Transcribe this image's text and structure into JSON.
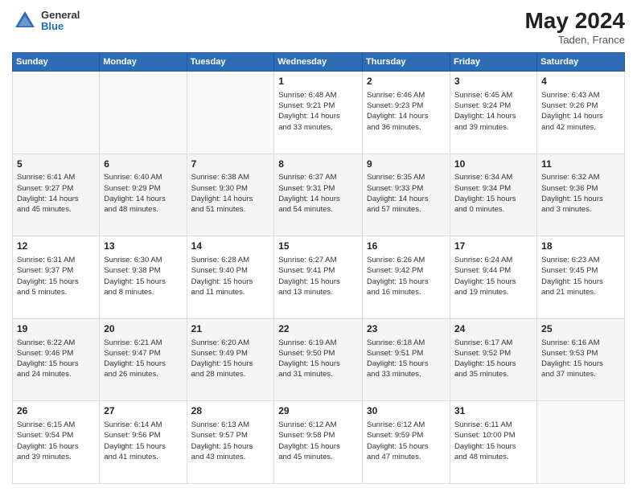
{
  "header": {
    "logo": {
      "general": "General",
      "blue": "Blue"
    },
    "title": "May 2024",
    "location": "Taden, France"
  },
  "calendar": {
    "days_of_week": [
      "Sunday",
      "Monday",
      "Tuesday",
      "Wednesday",
      "Thursday",
      "Friday",
      "Saturday"
    ],
    "weeks": [
      [
        {
          "day": "",
          "info": ""
        },
        {
          "day": "",
          "info": ""
        },
        {
          "day": "",
          "info": ""
        },
        {
          "day": "1",
          "info": "Sunrise: 6:48 AM\nSunset: 9:21 PM\nDaylight: 14 hours\nand 33 minutes."
        },
        {
          "day": "2",
          "info": "Sunrise: 6:46 AM\nSunset: 9:23 PM\nDaylight: 14 hours\nand 36 minutes."
        },
        {
          "day": "3",
          "info": "Sunrise: 6:45 AM\nSunset: 9:24 PM\nDaylight: 14 hours\nand 39 minutes."
        },
        {
          "day": "4",
          "info": "Sunrise: 6:43 AM\nSunset: 9:26 PM\nDaylight: 14 hours\nand 42 minutes."
        }
      ],
      [
        {
          "day": "5",
          "info": "Sunrise: 6:41 AM\nSunset: 9:27 PM\nDaylight: 14 hours\nand 45 minutes."
        },
        {
          "day": "6",
          "info": "Sunrise: 6:40 AM\nSunset: 9:29 PM\nDaylight: 14 hours\nand 48 minutes."
        },
        {
          "day": "7",
          "info": "Sunrise: 6:38 AM\nSunset: 9:30 PM\nDaylight: 14 hours\nand 51 minutes."
        },
        {
          "day": "8",
          "info": "Sunrise: 6:37 AM\nSunset: 9:31 PM\nDaylight: 14 hours\nand 54 minutes."
        },
        {
          "day": "9",
          "info": "Sunrise: 6:35 AM\nSunset: 9:33 PM\nDaylight: 14 hours\nand 57 minutes."
        },
        {
          "day": "10",
          "info": "Sunrise: 6:34 AM\nSunset: 9:34 PM\nDaylight: 15 hours\nand 0 minutes."
        },
        {
          "day": "11",
          "info": "Sunrise: 6:32 AM\nSunset: 9:36 PM\nDaylight: 15 hours\nand 3 minutes."
        }
      ],
      [
        {
          "day": "12",
          "info": "Sunrise: 6:31 AM\nSunset: 9:37 PM\nDaylight: 15 hours\nand 5 minutes."
        },
        {
          "day": "13",
          "info": "Sunrise: 6:30 AM\nSunset: 9:38 PM\nDaylight: 15 hours\nand 8 minutes."
        },
        {
          "day": "14",
          "info": "Sunrise: 6:28 AM\nSunset: 9:40 PM\nDaylight: 15 hours\nand 11 minutes."
        },
        {
          "day": "15",
          "info": "Sunrise: 6:27 AM\nSunset: 9:41 PM\nDaylight: 15 hours\nand 13 minutes."
        },
        {
          "day": "16",
          "info": "Sunrise: 6:26 AM\nSunset: 9:42 PM\nDaylight: 15 hours\nand 16 minutes."
        },
        {
          "day": "17",
          "info": "Sunrise: 6:24 AM\nSunset: 9:44 PM\nDaylight: 15 hours\nand 19 minutes."
        },
        {
          "day": "18",
          "info": "Sunrise: 6:23 AM\nSunset: 9:45 PM\nDaylight: 15 hours\nand 21 minutes."
        }
      ],
      [
        {
          "day": "19",
          "info": "Sunrise: 6:22 AM\nSunset: 9:46 PM\nDaylight: 15 hours\nand 24 minutes."
        },
        {
          "day": "20",
          "info": "Sunrise: 6:21 AM\nSunset: 9:47 PM\nDaylight: 15 hours\nand 26 minutes."
        },
        {
          "day": "21",
          "info": "Sunrise: 6:20 AM\nSunset: 9:49 PM\nDaylight: 15 hours\nand 28 minutes."
        },
        {
          "day": "22",
          "info": "Sunrise: 6:19 AM\nSunset: 9:50 PM\nDaylight: 15 hours\nand 31 minutes."
        },
        {
          "day": "23",
          "info": "Sunrise: 6:18 AM\nSunset: 9:51 PM\nDaylight: 15 hours\nand 33 minutes."
        },
        {
          "day": "24",
          "info": "Sunrise: 6:17 AM\nSunset: 9:52 PM\nDaylight: 15 hours\nand 35 minutes."
        },
        {
          "day": "25",
          "info": "Sunrise: 6:16 AM\nSunset: 9:53 PM\nDaylight: 15 hours\nand 37 minutes."
        }
      ],
      [
        {
          "day": "26",
          "info": "Sunrise: 6:15 AM\nSunset: 9:54 PM\nDaylight: 15 hours\nand 39 minutes."
        },
        {
          "day": "27",
          "info": "Sunrise: 6:14 AM\nSunset: 9:56 PM\nDaylight: 15 hours\nand 41 minutes."
        },
        {
          "day": "28",
          "info": "Sunrise: 6:13 AM\nSunset: 9:57 PM\nDaylight: 15 hours\nand 43 minutes."
        },
        {
          "day": "29",
          "info": "Sunrise: 6:12 AM\nSunset: 9:58 PM\nDaylight: 15 hours\nand 45 minutes."
        },
        {
          "day": "30",
          "info": "Sunrise: 6:12 AM\nSunset: 9:59 PM\nDaylight: 15 hours\nand 47 minutes."
        },
        {
          "day": "31",
          "info": "Sunrise: 6:11 AM\nSunset: 10:00 PM\nDaylight: 15 hours\nand 48 minutes."
        },
        {
          "day": "",
          "info": ""
        }
      ]
    ]
  }
}
